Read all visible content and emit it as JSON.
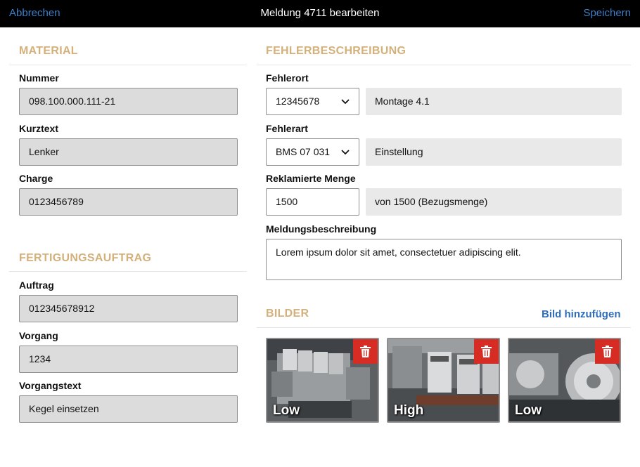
{
  "nav": {
    "cancel_label": "Abbrechen",
    "title": "Meldung 4711 bearbeiten",
    "save_label": "Speichern"
  },
  "material": {
    "section_title": "MATERIAL",
    "number_label": "Nummer",
    "number_value": "098.100.000.111-21",
    "shorttext_label": "Kurztext",
    "shorttext_value": "Lenker",
    "batch_label": "Charge",
    "batch_value": "0123456789"
  },
  "production_order": {
    "section_title": "FERTIGUNGSAUFTRAG",
    "order_label": "Auftrag",
    "order_value": "012345678912",
    "operation_label": "Vorgang",
    "operation_value": "1234",
    "operation_text_label": "Vorgangstext",
    "operation_text_value": "Kegel einsetzen"
  },
  "defect": {
    "section_title": "FEHLERBESCHREIBUNG",
    "location_label": "Fehlerort",
    "location_select": "12345678",
    "location_text": "Montage 4.1",
    "type_label": "Fehlerart",
    "type_select": "BMS 07 031",
    "type_text": "Einstellung",
    "quantity_label": "Reklamierte Menge",
    "quantity_value": "1500",
    "quantity_ref": "von 1500 (Bezugsmenge)",
    "description_label": "Meldungsbeschreibung",
    "description_value": "Lorem ipsum dolor sit amet, consectetuer adipiscing elit."
  },
  "images": {
    "section_title": "BILDER",
    "add_label": "Bild hinzufügen",
    "items": [
      {
        "caption": "Low",
        "delete_icon": "trash-icon"
      },
      {
        "caption": "High",
        "delete_icon": "trash-icon"
      },
      {
        "caption": "Low",
        "delete_icon": "trash-icon"
      }
    ]
  },
  "colors": {
    "accent_link": "#3d7fc9",
    "section_title": "#d4b07a",
    "delete": "#d62c24"
  }
}
